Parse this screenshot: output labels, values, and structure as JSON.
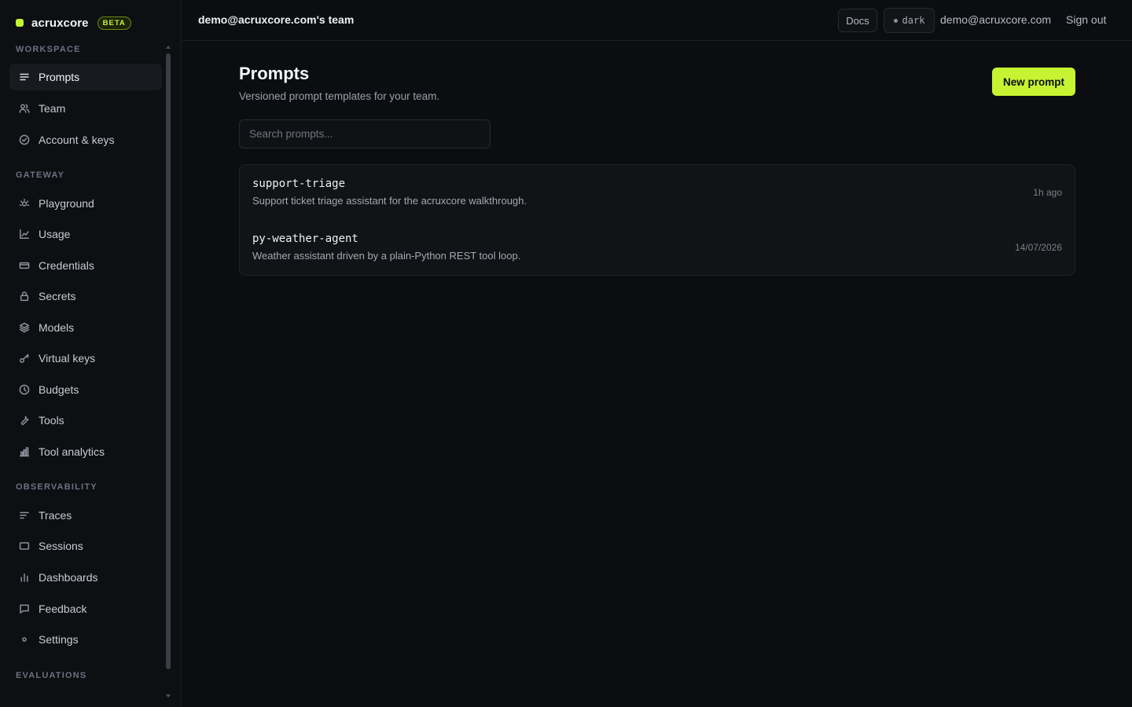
{
  "brand": {
    "name": "acruxcore",
    "badge": "BETA",
    "accent": "#c6f432"
  },
  "sidebar": {
    "sections": [
      {
        "label": "WORKSPACE",
        "items": [
          {
            "label": "Prompts",
            "icon": "lines-icon",
            "active": true
          },
          {
            "label": "Team",
            "icon": "users-icon"
          },
          {
            "label": "Account & keys",
            "icon": "check-circle-icon"
          }
        ]
      },
      {
        "label": "GATEWAY",
        "items": [
          {
            "label": "Playground",
            "icon": "sun-icon"
          },
          {
            "label": "Usage",
            "icon": "line-chart-icon"
          },
          {
            "label": "Credentials",
            "icon": "card-icon"
          },
          {
            "label": "Secrets",
            "icon": "lock-icon"
          },
          {
            "label": "Models",
            "icon": "layers-icon"
          },
          {
            "label": "Virtual keys",
            "icon": "key-icon"
          },
          {
            "label": "Budgets",
            "icon": "clock-icon"
          },
          {
            "label": "Tools",
            "icon": "wrench-icon"
          },
          {
            "label": "Tool analytics",
            "icon": "bar-chart-icon"
          }
        ]
      },
      {
        "label": "OBSERVABILITY",
        "items": [
          {
            "label": "Traces",
            "icon": "traces-icon"
          },
          {
            "label": "Sessions",
            "icon": "window-icon"
          },
          {
            "label": "Dashboards",
            "icon": "bars-icon"
          },
          {
            "label": "Feedback",
            "icon": "message-icon"
          },
          {
            "label": "Settings",
            "icon": "dot-icon"
          }
        ]
      },
      {
        "label": "EVALUATIONS",
        "items": []
      }
    ]
  },
  "topbar": {
    "team": "demo@acruxcore.com's team",
    "docs": "Docs",
    "theme": "dark",
    "email": "demo@acruxcore.com",
    "signout": "Sign out"
  },
  "main": {
    "title": "Prompts",
    "subtitle": "Versioned prompt templates for your team.",
    "new_button": "New prompt",
    "search_placeholder": "Search prompts...",
    "prompts": [
      {
        "name": "support-triage",
        "description": "Support ticket triage assistant for the acruxcore walkthrough.",
        "updated": "1h ago"
      },
      {
        "name": "py-weather-agent",
        "description": "Weather assistant driven by a plain-Python REST tool loop.",
        "updated": "14/07/2026"
      }
    ]
  }
}
